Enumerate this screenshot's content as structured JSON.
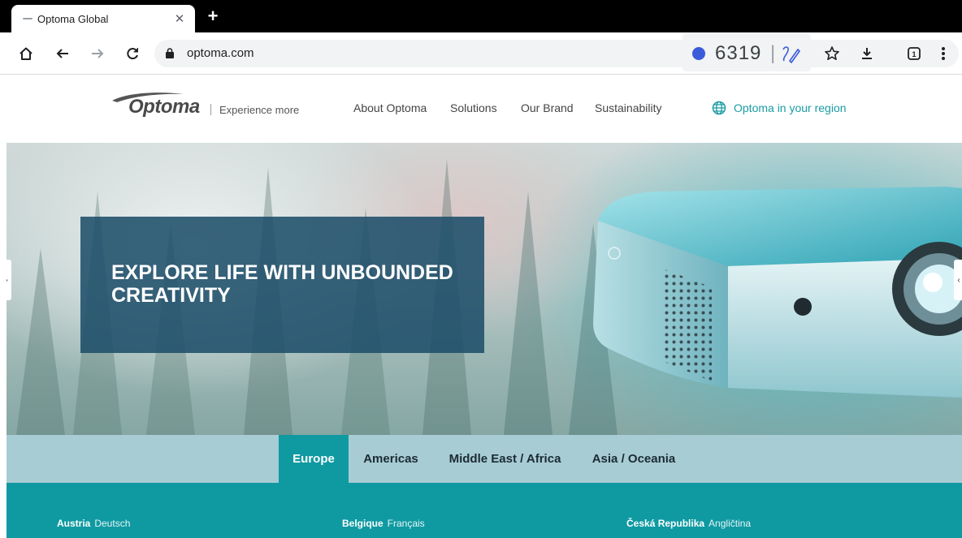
{
  "browser": {
    "tab_title": "Optoma Global",
    "url": "optoma.com",
    "counter": "6319"
  },
  "header": {
    "logo_text": "Optoma",
    "tagline": "Experience more",
    "nav": [
      "About Optoma",
      "Solutions",
      "Our Brand",
      "Sustainability"
    ],
    "region_link": "Optoma in your region"
  },
  "hero": {
    "title": "EXPLORE LIFE WITH UNBOUNDED CREATIVITY"
  },
  "regions": {
    "tabs": [
      "Europe",
      "Americas",
      "Middle East / Africa",
      "Asia / Oceania"
    ],
    "active": "Europe"
  },
  "countries": [
    {
      "name": "Austria",
      "language": "Deutsch"
    },
    {
      "name": "Belgique",
      "language": "Français"
    },
    {
      "name": "Česká Republika",
      "language": "Angličtina"
    }
  ],
  "colors": {
    "accent_teal": "#0f9aa2",
    "region_bar": "#a8ccd3",
    "hero_panel": "#1e4f6a"
  }
}
